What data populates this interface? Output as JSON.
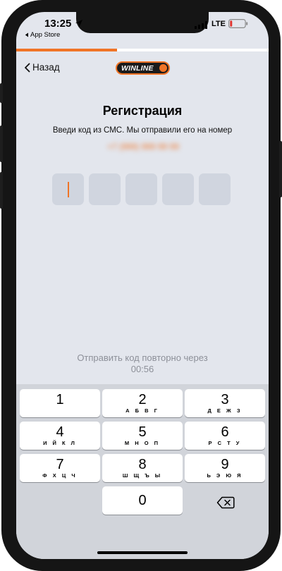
{
  "status_bar": {
    "time": "13:25",
    "back_app": "App Store",
    "network": "LTE",
    "battery_level": 0.12
  },
  "progress": {
    "value": 0.4,
    "color": "#f07426"
  },
  "nav": {
    "back_label": "Назад",
    "logo_text": "WINLINE"
  },
  "main": {
    "title": "Регистрация",
    "subtitle": "Введи код из СМС. Мы отправили его на номер",
    "phone_number": "+7 (999) 999 99 99",
    "code_cells": 5,
    "resend_text": "Отправить код повторно через",
    "resend_timer": "00:56"
  },
  "keypad": {
    "keys": [
      {
        "digit": "1",
        "letters": ""
      },
      {
        "digit": "2",
        "letters": "А Б В Г"
      },
      {
        "digit": "3",
        "letters": "Д Е Ж З"
      },
      {
        "digit": "4",
        "letters": "И Й К Л"
      },
      {
        "digit": "5",
        "letters": "М Н О П"
      },
      {
        "digit": "6",
        "letters": "Р С Т У"
      },
      {
        "digit": "7",
        "letters": "Ф Х Ц Ч"
      },
      {
        "digit": "8",
        "letters": "Ш Щ Ъ Ы"
      },
      {
        "digit": "9",
        "letters": "Ь Э Ю Я"
      },
      {
        "digit": "0",
        "letters": ""
      }
    ],
    "delete_icon": "backspace-icon"
  },
  "colors": {
    "accent": "#f07426",
    "background": "#e3e6ed",
    "keyboard": "#d1d4da"
  }
}
